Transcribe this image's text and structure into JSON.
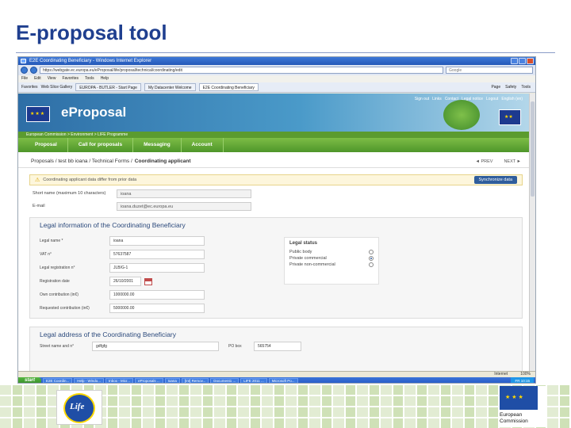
{
  "slide": {
    "title": "E-proposal tool"
  },
  "browser": {
    "window_title": "E2E Coordinating Beneficiary - Windows Internet Explorer",
    "address": "https://webgate.ec.europa.eu/eProposal/life/proposal/technical/coordinating/edit",
    "search_placeholder": "Google",
    "menu": [
      "File",
      "Edit",
      "View",
      "Favorites",
      "Tools",
      "Help"
    ],
    "favorites_label": "Favorites",
    "web_slice_label": "Web Slice Gallery",
    "tabs": [
      "EUROPA - BUTLER - Start Page",
      "My Datacenter Welcome",
      "E2E Coordinating Beneficiary"
    ],
    "tools": [
      "Page",
      "Safety",
      "Tools"
    ]
  },
  "site": {
    "top_links": [
      "Sign out",
      "Links",
      "Contact",
      "Legal notice",
      "Logout",
      "English (en)"
    ],
    "brand": "eProposal",
    "breadcrumb": "European Commission > Environment > LIFE Programme",
    "nav": [
      "Proposal",
      "Call for proposals",
      "Messaging",
      "Account"
    ]
  },
  "path": {
    "prefix": "Proposals / test bb ioana / Technical Forms /",
    "current": "Coordinating applicant",
    "prev": "◄ PREV",
    "next": "NEXT ►"
  },
  "warning": {
    "icon": "⚠",
    "text": "Coordinating applicant data differ from prior data",
    "button": "Synchronize data"
  },
  "short_fields": [
    {
      "label": "Short name (maximum 10 characters)",
      "value": "ioana"
    },
    {
      "label": "E-mail",
      "value": "ioana.duzet@ec.europa.eu"
    }
  ],
  "legal_info": {
    "title": "Legal information of the Coordinating Beneficiary",
    "fields": [
      {
        "label": "Legal name *",
        "value": "ioana"
      },
      {
        "label": "VAT n°",
        "value": "57637587"
      },
      {
        "label": "Legal registration n°",
        "value": "JLB/G-1"
      },
      {
        "label": "Registration date",
        "value": "26/10/2001"
      },
      {
        "label": "Own contribution (in€)",
        "value": "1000000.00"
      },
      {
        "label": "Requested contribution (in€)",
        "value": "5000000.00"
      }
    ],
    "status_title": "Legal status",
    "statuses": [
      {
        "label": "Public body",
        "checked": false
      },
      {
        "label": "Private commercial",
        "checked": true
      },
      {
        "label": "Private non-commercial",
        "checked": false
      }
    ]
  },
  "legal_address": {
    "title": "Legal address of the Coordinating Beneficiary",
    "street_label": "Street name and n°",
    "street_value": "gdfgfg",
    "po_label": "PO box",
    "po_value": "565754"
  },
  "status_bar": {
    "zone": "Internet",
    "zoom": "100%"
  },
  "taskbar": {
    "start": "start",
    "tasks": [
      "E2E Coordin...",
      "Help - Windo...",
      "Inbox - Micr...",
      "eProposals ...",
      "Ioana",
      "[Int] Remov...",
      "Document1 ...",
      "LIFE 2011 ...",
      "Microsoft Po..."
    ],
    "tray": "FR 10:15"
  },
  "footer": {
    "life_text": "Life",
    "ec_text": "European Commission"
  }
}
